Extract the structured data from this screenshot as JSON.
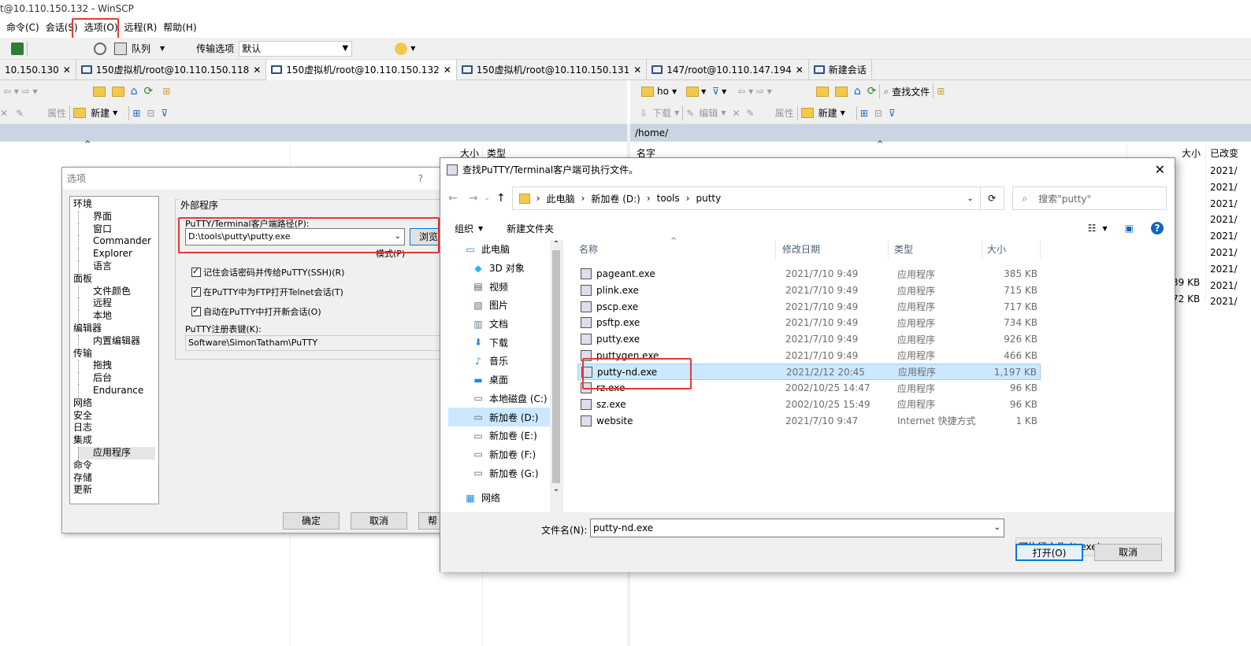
{
  "window": {
    "title": "t@10.110.150.132 - WinSCP"
  },
  "menu": [
    "命令(C)",
    "会话(S)",
    "选项(O)",
    "远程(R)",
    "帮助(H)"
  ],
  "toolbar": {
    "queue": "队列",
    "transfer_label": "传输选项",
    "transfer_value": "默认"
  },
  "tabs": [
    "10.150.130",
    "150虚拟机/root@10.110.150.118",
    "150虚拟机/root@10.110.150.132",
    "150虚拟机/root@10.110.150.131",
    "147/root@10.110.147.194",
    "新建会话"
  ],
  "left_panel": {
    "props": "属性",
    "new": "新建",
    "col_size": "大小",
    "col_type": "类型"
  },
  "right_panel": {
    "path_short": "ho",
    "download": "下载",
    "edit": "编辑",
    "props": "属性",
    "new": "新建",
    "find": "查找文件",
    "path": "/home/",
    "col_name": "名字",
    "col_size": "大小",
    "col_changed": "已改变",
    "changed": [
      "2021/",
      "2021/",
      "2021/",
      "2021/",
      "2021/",
      "2021/",
      "2021/",
      "2021/",
      "2021/"
    ],
    "sizes": [
      "39 KB",
      "72 KB"
    ]
  },
  "options_dialog": {
    "title": "选项",
    "help": "?",
    "tree": [
      {
        "label": "环境",
        "level": 1
      },
      {
        "label": "界面",
        "level": 2
      },
      {
        "label": "窗口",
        "level": 2
      },
      {
        "label": "Commander",
        "level": 2
      },
      {
        "label": "Explorer",
        "level": 2
      },
      {
        "label": "语言",
        "level": 2
      },
      {
        "label": "面板",
        "level": 1
      },
      {
        "label": "文件颜色",
        "level": 2
      },
      {
        "label": "远程",
        "level": 2
      },
      {
        "label": "本地",
        "level": 2
      },
      {
        "label": "编辑器",
        "level": 1
      },
      {
        "label": "内置编辑器",
        "level": 2
      },
      {
        "label": "传输",
        "level": 1
      },
      {
        "label": "拖拽",
        "level": 2
      },
      {
        "label": "后台",
        "level": 2
      },
      {
        "label": "Endurance",
        "level": 2
      },
      {
        "label": "网络",
        "level": 1
      },
      {
        "label": "安全",
        "level": 1
      },
      {
        "label": "日志",
        "level": 1
      },
      {
        "label": "集成",
        "level": 1
      },
      {
        "label": "应用程序",
        "level": 2,
        "selected": true
      },
      {
        "label": "命令",
        "level": 1
      },
      {
        "label": "存储",
        "level": 1
      },
      {
        "label": "更新",
        "level": 1
      }
    ],
    "group": "外部程序",
    "path_label": "PuTTY/Terminal客户端路径(P):",
    "path_value": "D:\\tools\\putty\\putty.exe",
    "browse": "浏览",
    "patterns": "模式(P)",
    "checks": [
      "记住会话密码并传给PuTTY(SSH)(R)",
      "在PuTTY中为FTP打开Telnet会话(T)",
      "自动在PuTTY中打开新会话(O)"
    ],
    "regkey_label": "PuTTY注册表键(K):",
    "regkey_value": "Software\\SimonTatham\\PuTTY",
    "ok": "确定",
    "cancel": "取消",
    "help_btn": "帮"
  },
  "file_dialog": {
    "title": "查找PuTTY/Terminal客户端可执行文件。",
    "crumbs": [
      "此电脑",
      "新加卷 (D:)",
      "tools",
      "putty"
    ],
    "search_placeholder": "搜索\"putty\"",
    "organize": "组织",
    "new_folder": "新建文件夹",
    "nav": [
      {
        "label": "此电脑",
        "icon": "pc"
      },
      {
        "label": "3D 对象",
        "icon": "cube"
      },
      {
        "label": "视频",
        "icon": "video"
      },
      {
        "label": "图片",
        "icon": "picture"
      },
      {
        "label": "文档",
        "icon": "doc"
      },
      {
        "label": "下载",
        "icon": "download"
      },
      {
        "label": "音乐",
        "icon": "music"
      },
      {
        "label": "桌面",
        "icon": "desktop"
      },
      {
        "label": "本地磁盘 (C:)",
        "icon": "drive"
      },
      {
        "label": "新加卷 (D:)",
        "icon": "drive",
        "selected": true
      },
      {
        "label": "新加卷 (E:)",
        "icon": "drive"
      },
      {
        "label": "新加卷 (F:)",
        "icon": "drive"
      },
      {
        "label": "新加卷 (G:)",
        "icon": "drive"
      },
      {
        "label": "网络",
        "icon": "network"
      }
    ],
    "columns": [
      "名称",
      "修改日期",
      "类型",
      "大小"
    ],
    "files": [
      {
        "name": "pageant.exe",
        "date": "2021/7/10 9:49",
        "type": "应用程序",
        "size": "385 KB"
      },
      {
        "name": "plink.exe",
        "date": "2021/7/10 9:49",
        "type": "应用程序",
        "size": "715 KB"
      },
      {
        "name": "pscp.exe",
        "date": "2021/7/10 9:49",
        "type": "应用程序",
        "size": "717 KB"
      },
      {
        "name": "psftp.exe",
        "date": "2021/7/10 9:49",
        "type": "应用程序",
        "size": "734 KB"
      },
      {
        "name": "putty.exe",
        "date": "2021/7/10 9:49",
        "type": "应用程序",
        "size": "926 KB"
      },
      {
        "name": "puttygen.exe",
        "date": "2021/7/10 9:49",
        "type": "应用程序",
        "size": "466 KB"
      },
      {
        "name": "putty-nd.exe",
        "date": "2021/2/12 20:45",
        "type": "应用程序",
        "size": "1,197 KB",
        "selected": true
      },
      {
        "name": "rz.exe",
        "date": "2002/10/25 14:47",
        "type": "应用程序",
        "size": "96 KB"
      },
      {
        "name": "sz.exe",
        "date": "2002/10/25 15:49",
        "type": "应用程序",
        "size": "96 KB"
      },
      {
        "name": "website",
        "date": "2021/7/10 9:47",
        "type": "Internet 快捷方式",
        "size": "1 KB"
      }
    ],
    "filename_label": "文件名(N):",
    "filename_value": "putty-nd.exe",
    "filter": "可执行文件 (*.exe)",
    "open": "打开(O)",
    "cancel": "取消"
  },
  "colors": {
    "highlight": "#e53935",
    "selection": "#cce8ff",
    "path_bar": "#c9d5e3"
  }
}
